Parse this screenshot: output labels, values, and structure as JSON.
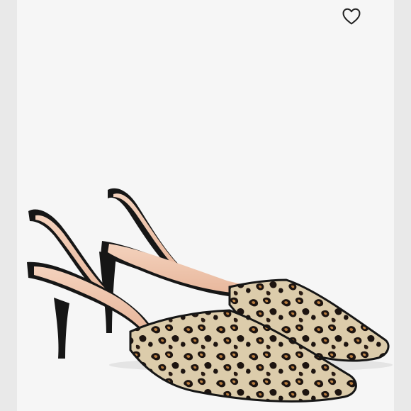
{
  "listing": {
    "image_subject": "leopard-print-calf-hair-slingback-heels",
    "favorite_icon": "heart-outline-icon"
  },
  "colors": {
    "background": "#f6f6f6",
    "edge": "#e9e9e9",
    "heart_stroke": "#222222",
    "suede_black": "#161616",
    "lining_blush": "#f0c7ae",
    "leopard_base": "#d8c7a3",
    "leopard_tan": "#b97c3e",
    "leopard_spot": "#1d1410"
  }
}
